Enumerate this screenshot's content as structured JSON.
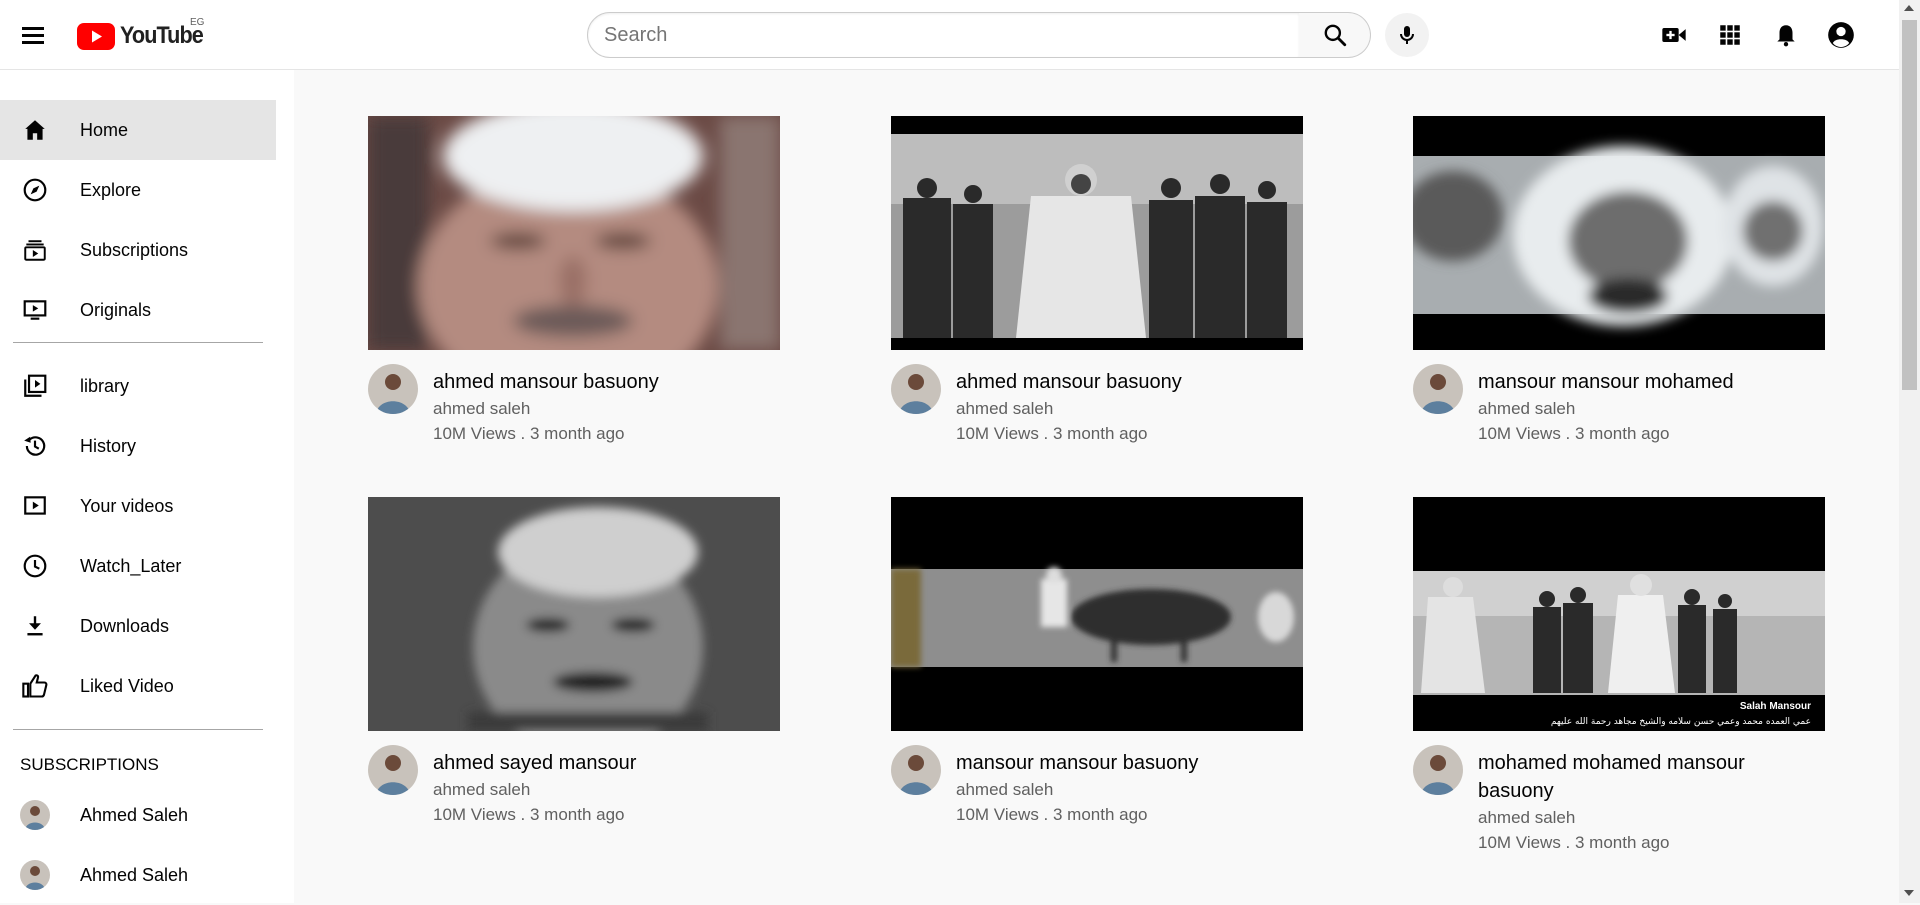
{
  "header": {
    "logo_text": "YouTube",
    "country_code": "EG",
    "search_placeholder": "Search",
    "icons": [
      "menu-icon",
      "search-icon",
      "mic-icon",
      "create-video-icon",
      "apps-icon",
      "notifications-icon",
      "account-icon"
    ]
  },
  "sidebar": {
    "items": [
      {
        "label": "Home",
        "icon": "home-icon"
      },
      {
        "label": "Explore",
        "icon": "compass-icon"
      },
      {
        "label": "Subscriptions",
        "icon": "subscriptions-icon"
      },
      {
        "label": "Originals",
        "icon": "originals-icon"
      },
      {
        "label": "library",
        "icon": "library-icon"
      },
      {
        "label": "History",
        "icon": "history-icon"
      },
      {
        "label": "Your videos",
        "icon": "your-videos-icon"
      },
      {
        "label": "Watch_Later",
        "icon": "clock-icon"
      },
      {
        "label": "Downloads",
        "icon": "download-icon"
      },
      {
        "label": "Liked Video",
        "icon": "thumbs-up-icon"
      }
    ],
    "subscriptions_title": "SUBSCRIPTIONS",
    "subscriptions": [
      {
        "name": "Ahmed Saleh"
      },
      {
        "name": "Ahmed Saleh"
      }
    ]
  },
  "videos": [
    {
      "title": "ahmed mansour basuony",
      "channel": "ahmed saleh",
      "meta": "10M Views . 3 month ago"
    },
    {
      "title": "ahmed mansour basuony",
      "channel": "ahmed saleh",
      "meta": "10M Views . 3 month ago"
    },
    {
      "title": "mansour mansour mohamed",
      "channel": "ahmed saleh",
      "meta": "10M Views . 3 month ago"
    },
    {
      "title": "ahmed sayed mansour",
      "channel": "ahmed saleh",
      "meta": "10M Views . 3 month ago"
    },
    {
      "title": "mansour mansour basuony",
      "channel": "ahmed saleh",
      "meta": "10M Views . 3 month ago"
    },
    {
      "title": "mohamed mohamed mansour basuony",
      "channel": "ahmed saleh",
      "meta": "10M Views . 3 month ago"
    }
  ],
  "thumbnail_captions": {
    "video_6_name": "Salah Mansour",
    "video_6_arabic": "عمي العمده محمد وعمي حسن سلامه والشيخ مجاهد رحمة الله عليهم"
  },
  "colors": {
    "brand_red": "#ff0000",
    "active_item_bg": "#e5e5e5",
    "page_bg": "#f9f9f9",
    "secondary_text": "#606060"
  }
}
